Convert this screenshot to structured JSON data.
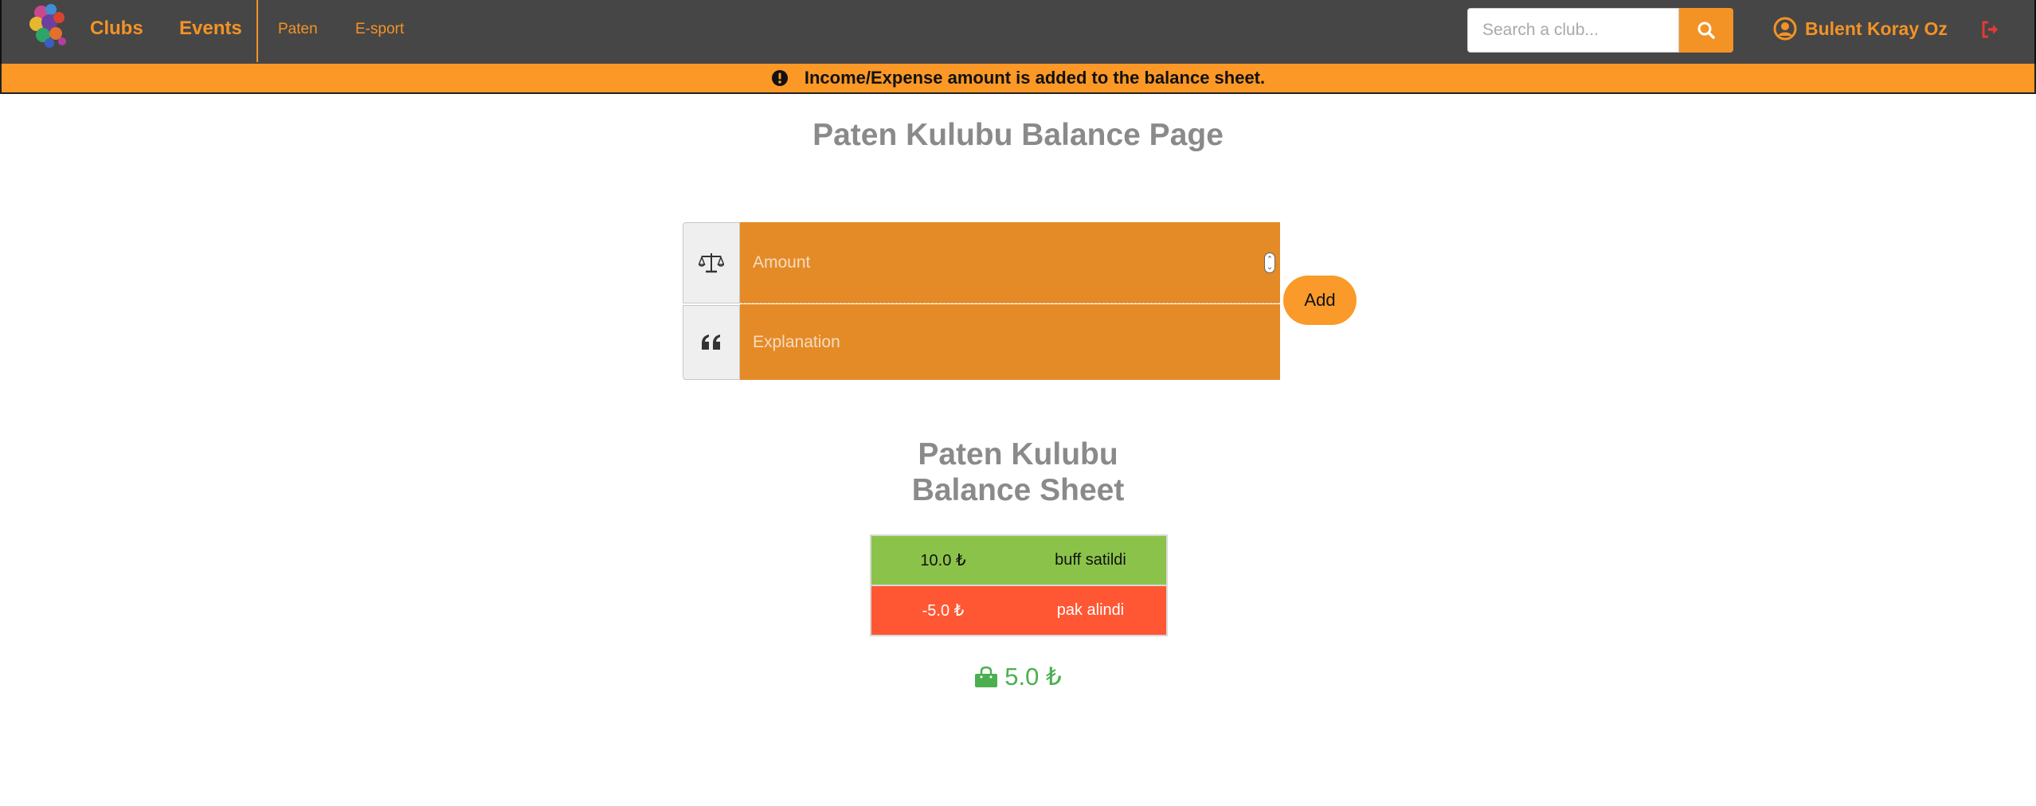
{
  "navbar": {
    "clubs_label": "Clubs",
    "events_label": "Events",
    "club_links": [
      "Paten",
      "E-sport"
    ],
    "search_placeholder": "Search a club...",
    "user_name": "Bulent Koray Oz"
  },
  "alert": {
    "message": "Income/Expense amount is added to the balance sheet."
  },
  "page": {
    "title": "Paten Kulubu Balance Page"
  },
  "form": {
    "amount_placeholder": "Amount",
    "explanation_placeholder": "Explanation",
    "add_label": "Add"
  },
  "sheet": {
    "title_line1": "Paten Kulubu",
    "title_line2": "Balance Sheet",
    "rows": [
      {
        "amount": "10.0 ₺",
        "explanation": "buff satildi",
        "type": "income"
      },
      {
        "amount": "-5.0 ₺",
        "explanation": "pak alindi",
        "type": "expense"
      }
    ],
    "total": "5.0 ₺"
  },
  "colors": {
    "accent": "#f39325",
    "navbar": "#464646",
    "alert": "#fc9826",
    "income": "#8bc34a",
    "expense": "#ff5733",
    "total": "#4caf50"
  },
  "icons": {
    "logo": "club-logo",
    "search": "search-icon",
    "user": "user-circle-icon",
    "logout": "sign-out-icon",
    "alert": "exclamation-circle-icon",
    "amount": "balance-scale-icon",
    "explanation": "quote-icon",
    "total": "shopping-bag-icon"
  }
}
